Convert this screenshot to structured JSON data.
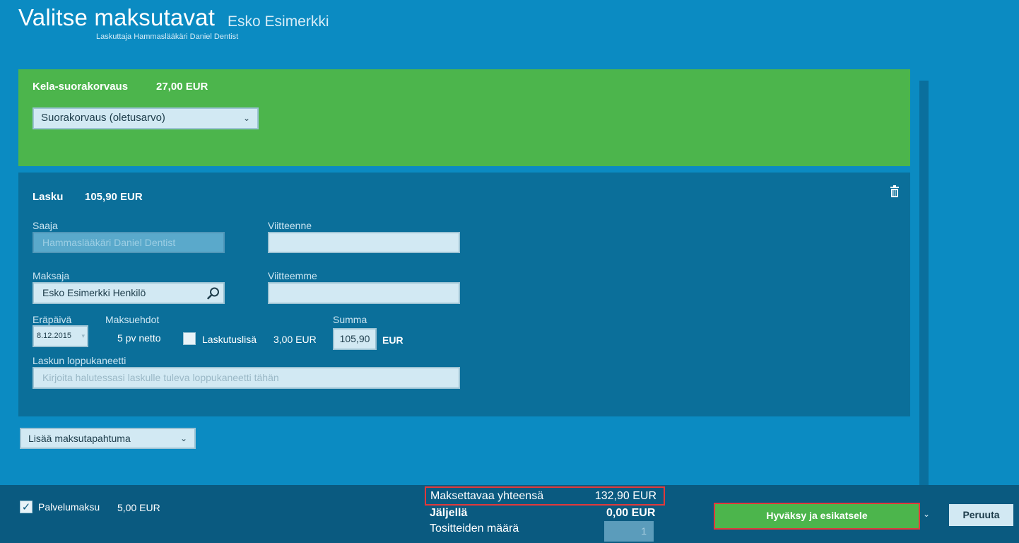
{
  "header": {
    "title": "Valitse maksutavat",
    "customer": "Esko Esimerkki",
    "biller": "Laskuttaja Hammaslääkäri Daniel Dentist"
  },
  "kela": {
    "title": "Kela-suorakorvaus",
    "amount": "27,00 EUR",
    "select_value": "Suorakorvaus (oletusarvo)"
  },
  "invoice": {
    "title": "Lasku",
    "amount": "105,90 EUR",
    "recipient_label": "Saaja",
    "recipient_value": "Hammaslääkäri Daniel Dentist",
    "your_ref_label": "Viitteenne",
    "your_ref_value": "",
    "payer_label": "Maksaja",
    "payer_value": "Esko Esimerkki Henkilö",
    "our_ref_label": "Viitteemme",
    "our_ref_value": "",
    "due_date_label": "Eräpäivä",
    "due_date_value": "8.12.2015",
    "terms_label": "Maksuehdot",
    "terms_value": "5 pv netto",
    "billing_fee_label": "Laskutuslisä",
    "billing_fee_amount": "3,00 EUR",
    "sum_label": "Summa",
    "sum_value": "105,90",
    "sum_unit": "EUR",
    "comment_label": "Laskun loppukaneetti",
    "comment_placeholder": "Kirjoita halutessasi laskulle tuleva loppukaneetti tähän"
  },
  "add_payment": {
    "label": "Lisää maksutapahtuma"
  },
  "footer": {
    "service_fee_label": "Palvelumaksu",
    "service_fee_amount": "5,00 EUR",
    "total_label": "Maksettavaa yhteensä",
    "total_value": "132,90 EUR",
    "remaining_label": "Jäljellä",
    "remaining_value": "0,00 EUR",
    "voucher_count_label": "Tositteiden määrä",
    "voucher_count_value": "1",
    "approve_button": "Hyväksy ja esikatsele",
    "cancel_button": "Peruuta"
  },
  "icons": {
    "chevron": "chevron-down-icon",
    "search": "search-icon",
    "trash": "trash-icon",
    "check": "check-icon"
  },
  "colors": {
    "background": "#0b8bc2",
    "green": "#4cb54c",
    "dark_panel": "#0b6f9a",
    "footer": "#0a5a80",
    "highlight": "#e2393b"
  }
}
